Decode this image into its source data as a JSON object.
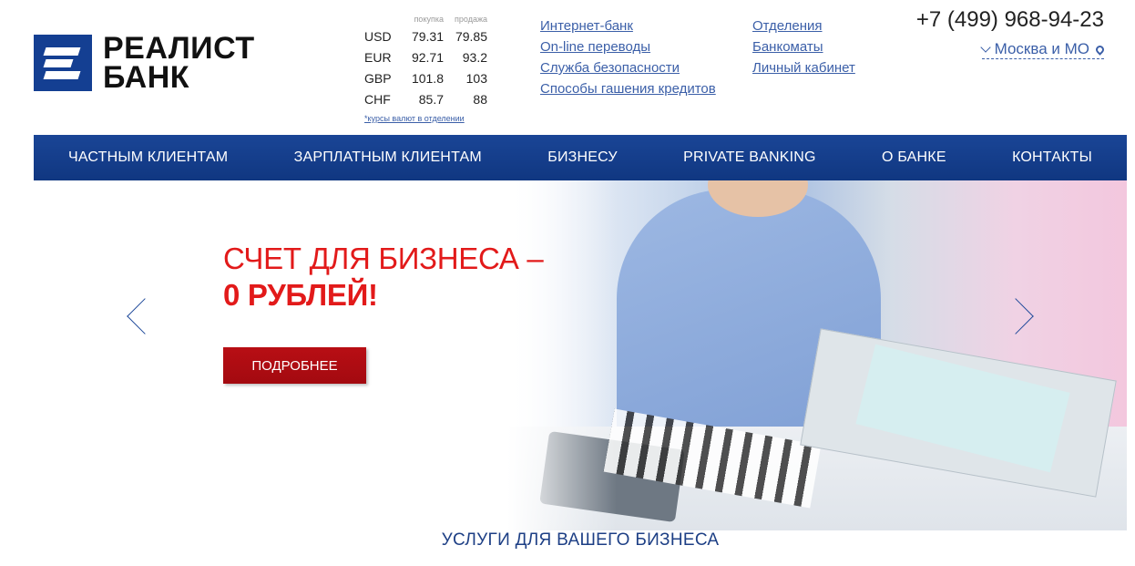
{
  "brand": {
    "name_line1": "РЕАЛИСТ",
    "name_line2": "БАНК",
    "color": "#143f92"
  },
  "rates": {
    "buy_label": "покупка",
    "sell_label": "продажа",
    "rows": [
      {
        "cur": "USD",
        "buy": "79.31",
        "sell": "79.85"
      },
      {
        "cur": "EUR",
        "buy": "92.71",
        "sell": "93.2"
      },
      {
        "cur": "GBP",
        "buy": "101.8",
        "sell": "103"
      },
      {
        "cur": "CHF",
        "buy": "85.7",
        "sell": "88"
      }
    ],
    "note": "*курсы валют в отделении"
  },
  "links_col1": [
    "Интернет-банк",
    "On-line переводы",
    "Служба безопасности",
    "Способы гашения кредитов"
  ],
  "links_col2": [
    "Отделения",
    "Банкоматы",
    "Личный кабинет"
  ],
  "contact": {
    "phone": "+7 (499) 968-94-23",
    "city": "Москва и МО"
  },
  "nav": [
    "ЧАСТНЫМ КЛИЕНТАМ",
    "ЗАРПЛАТНЫМ КЛИЕНТАМ",
    "БИЗНЕСУ",
    "PRIVATE BANKING",
    "О БАНКЕ",
    "КОНТАКТЫ"
  ],
  "hero": {
    "title_line1": "СЧЕТ ДЛЯ БИЗНЕСА –",
    "title_line2": "0 РУБЛЕЙ!",
    "button": "ПОДРОБНЕЕ",
    "accent": "#e21a1a"
  },
  "section_title": "УСЛУГИ ДЛЯ ВАШЕГО БИЗНЕСА"
}
